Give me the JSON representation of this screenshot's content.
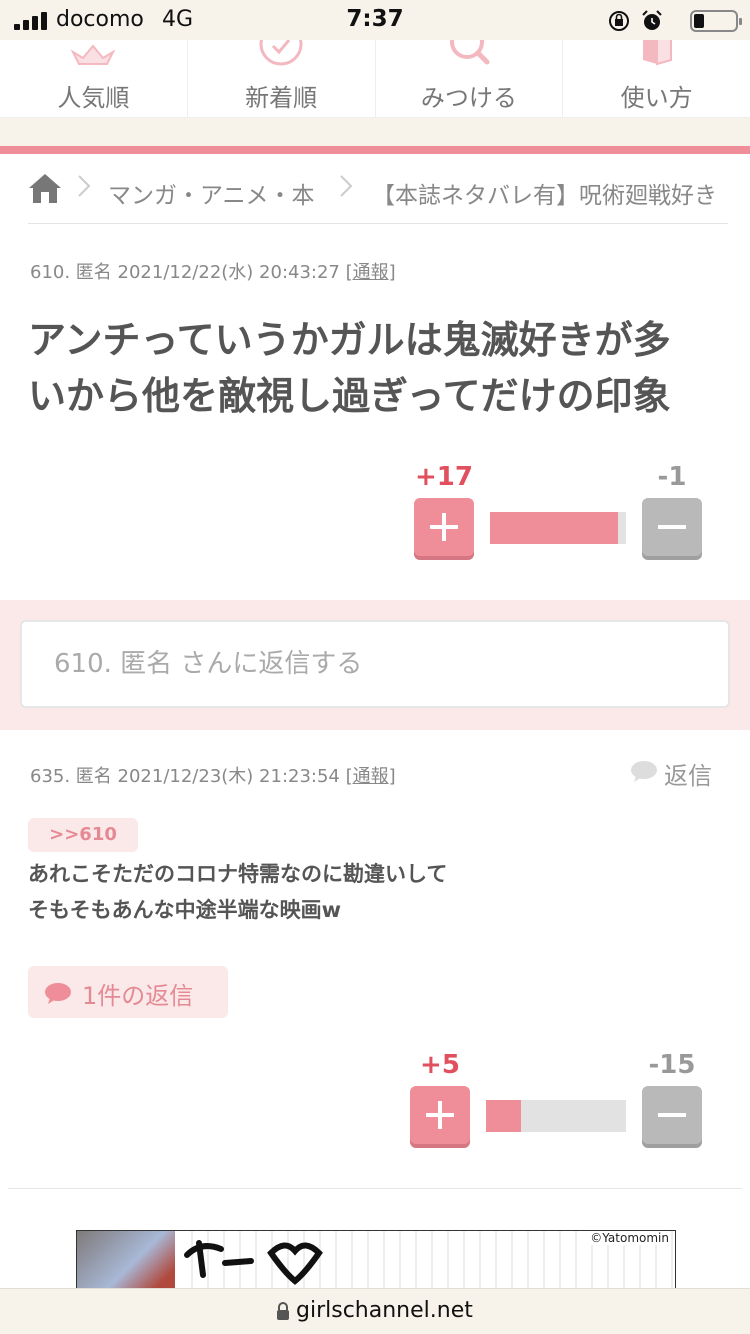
{
  "status_bar": {
    "carrier": "docomo",
    "network": "4G",
    "time": "7:37"
  },
  "nav": {
    "items": [
      {
        "label": "人気順",
        "icon": "crown-icon"
      },
      {
        "label": "新着順",
        "icon": "heart-icon"
      },
      {
        "label": "みつける",
        "icon": "search-icon"
      },
      {
        "label": "使い方",
        "icon": "book-icon"
      }
    ]
  },
  "breadcrumb": {
    "items": [
      "マンガ・アニメ・本",
      "【本誌ネタバレ有】呪術廻戦好き"
    ]
  },
  "comments": [
    {
      "meta": "610. 匿名 2021/12/22(水) 20:43:27",
      "report": "[通報]",
      "body": [
        "アンチっていうかガルは鬼滅好きが多",
        "いから他を敵視し過ぎってだけの印象"
      ],
      "plus": "+17",
      "minus": "-1",
      "plus_ratio": 0.94
    },
    {
      "meta": "635. 匿名 2021/12/23(木) 21:23:54",
      "report": "[通報]",
      "reply_label": "返信",
      "anchor": ">>610",
      "body": [
        "あれこそただのコロナ特需なのに勘違いして",
        "そもそもあんな中途半端な映画w"
      ],
      "replies_label": "1件の返信",
      "plus": "+5",
      "minus": "-15",
      "plus_ratio": 0.25
    }
  ],
  "reply_box": {
    "placeholder": "610. 匿名 さんに返信する"
  },
  "ad": {
    "credit": "©Yatomomin"
  },
  "url_bar": {
    "url": "girlschannel.net"
  },
  "colors": {
    "accent": "#ef8e99",
    "plus_count": "#e0505f",
    "reply_bg": "#fbe8e8",
    "cream": "#f7f2ea"
  }
}
